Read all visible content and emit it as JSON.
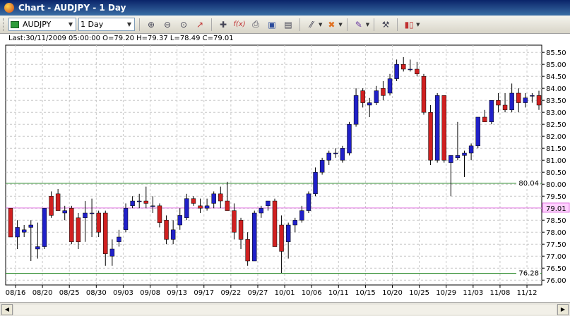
{
  "window": {
    "title": "Chart - AUDJPY - 1 Day"
  },
  "toolbar": {
    "symbol": "AUDJPY",
    "timeframe": "1 Day",
    "icons": [
      "zoom-in-icon",
      "zoom-out-icon",
      "zoom-fit-icon",
      "cursor-icon",
      "crosshair-icon",
      "fx-icon",
      "print-icon",
      "save-icon",
      "page-icon",
      "line-tool-icon",
      "fibonacci-icon",
      "drawing-icon",
      "settings-icon",
      "bars-icon"
    ]
  },
  "info": {
    "text": "Last:30/11/2009 05:00:00 O=79.20 H=79.37 L=78.49 C=79.01"
  },
  "colors": {
    "up": "#2020c8",
    "down": "#d02020",
    "grid": "#c8c8c8",
    "level_line": "#2a8a2a",
    "price_line": "#e070e0"
  },
  "chart_data": {
    "type": "candlestick",
    "symbol": "AUDJPY",
    "timeframe": "1 Day",
    "xlabels": [
      "08/16",
      "08/20",
      "08/25",
      "08/30",
      "09/03",
      "09/08",
      "09/13",
      "09/17",
      "09/22",
      "09/27",
      "10/01",
      "10/06",
      "10/11",
      "10/15",
      "10/20",
      "10/25",
      "10/29",
      "11/03",
      "11/08",
      "11/12"
    ],
    "ylabels": [
      "76.00",
      "76.50",
      "77.00",
      "77.50",
      "78.00",
      "78.50",
      "79.00",
      "79.50",
      "80.00",
      "80.50",
      "81.00",
      "81.50",
      "82.00",
      "82.50",
      "83.00",
      "83.50",
      "84.00",
      "84.50",
      "85.00",
      "85.50"
    ],
    "ylim": [
      75.8,
      85.8
    ],
    "levels": [
      {
        "label": "80.04",
        "value": 80.04
      },
      {
        "label": "76.28",
        "value": 76.28
      }
    ],
    "current_price": {
      "label": "79.01",
      "value": 79.01
    },
    "ohlc": [
      [
        79.0,
        79.0,
        77.9,
        77.8
      ],
      [
        77.8,
        78.5,
        77.3,
        78.2
      ],
      [
        78.0,
        78.3,
        77.8,
        78.1
      ],
      [
        78.2,
        78.5,
        76.8,
        78.3
      ],
      [
        77.3,
        78.4,
        76.9,
        77.4
      ],
      [
        77.4,
        79.0,
        77.3,
        79.0
      ],
      [
        79.5,
        79.7,
        78.6,
        78.7
      ],
      [
        79.6,
        79.8,
        78.9,
        78.9
      ],
      [
        78.8,
        79.1,
        78.5,
        78.9
      ],
      [
        79.0,
        79.1,
        77.5,
        77.6
      ],
      [
        78.6,
        78.8,
        77.3,
        77.6
      ],
      [
        78.6,
        79.3,
        77.6,
        78.8
      ],
      [
        78.8,
        79.4,
        77.8,
        78.8
      ],
      [
        78.8,
        78.9,
        77.8,
        78.0
      ],
      [
        78.8,
        78.9,
        76.6,
        77.1
      ],
      [
        77.0,
        77.7,
        76.6,
        77.3
      ],
      [
        77.6,
        78.1,
        77.4,
        77.8
      ],
      [
        78.1,
        79.2,
        78.0,
        79.0
      ],
      [
        79.1,
        79.5,
        79.0,
        79.3
      ],
      [
        79.3,
        79.6,
        79.0,
        79.3
      ],
      [
        79.3,
        79.9,
        79.0,
        79.2
      ],
      [
        79.1,
        79.5,
        78.8,
        79.1
      ],
      [
        79.1,
        79.2,
        78.2,
        78.4
      ],
      [
        78.5,
        78.7,
        77.5,
        77.7
      ],
      [
        77.7,
        78.5,
        77.5,
        78.1
      ],
      [
        78.3,
        79.0,
        78.1,
        78.7
      ],
      [
        78.6,
        79.6,
        78.5,
        79.4
      ],
      [
        79.4,
        79.5,
        79.1,
        79.2
      ],
      [
        79.1,
        79.4,
        78.8,
        79.0
      ],
      [
        79.0,
        79.4,
        78.9,
        79.1
      ],
      [
        79.2,
        79.7,
        79.0,
        79.6
      ],
      [
        79.6,
        79.9,
        79.0,
        79.3
      ],
      [
        79.3,
        80.1,
        79.1,
        78.9
      ],
      [
        78.9,
        79.2,
        77.7,
        78.0
      ],
      [
        78.5,
        78.6,
        77.3,
        77.7
      ],
      [
        77.7,
        78.0,
        76.6,
        76.8
      ],
      [
        76.8,
        78.9,
        76.8,
        78.8
      ],
      [
        78.8,
        79.1,
        78.6,
        79.0
      ],
      [
        79.1,
        79.3,
        78.9,
        79.3
      ],
      [
        79.3,
        79.4,
        77.8,
        77.4
      ],
      [
        78.3,
        78.7,
        76.3,
        77.2
      ],
      [
        77.6,
        78.4,
        76.9,
        78.3
      ],
      [
        78.3,
        78.6,
        78.0,
        78.5
      ],
      [
        78.5,
        79.1,
        78.4,
        78.9
      ],
      [
        78.9,
        79.7,
        78.8,
        79.6
      ],
      [
        79.6,
        80.7,
        79.5,
        80.5
      ],
      [
        80.5,
        81.1,
        80.4,
        81.0
      ],
      [
        81.0,
        81.4,
        80.8,
        81.3
      ],
      [
        81.3,
        81.5,
        81.1,
        81.3
      ],
      [
        81.0,
        81.6,
        80.9,
        81.5
      ],
      [
        81.3,
        82.6,
        81.2,
        82.5
      ],
      [
        82.5,
        84.0,
        82.4,
        83.7
      ],
      [
        83.9,
        84.0,
        83.2,
        83.4
      ],
      [
        83.3,
        83.6,
        82.8,
        83.4
      ],
      [
        83.4,
        84.1,
        83.3,
        83.9
      ],
      [
        84.0,
        84.3,
        83.5,
        83.7
      ],
      [
        83.8,
        84.6,
        83.7,
        84.4
      ],
      [
        84.4,
        85.2,
        84.3,
        85.0
      ],
      [
        85.0,
        85.3,
        84.7,
        84.8
      ],
      [
        84.8,
        85.2,
        84.7,
        84.8
      ],
      [
        84.8,
        85.1,
        84.5,
        84.6
      ],
      [
        84.5,
        84.6,
        82.9,
        83.0
      ],
      [
        83.0,
        83.3,
        80.8,
        81.0
      ],
      [
        81.0,
        83.8,
        80.9,
        83.7
      ],
      [
        83.7,
        83.7,
        80.9,
        81.0
      ],
      [
        80.9,
        81.2,
        79.5,
        81.2
      ],
      [
        81.1,
        82.6,
        81.0,
        81.2
      ],
      [
        81.2,
        81.4,
        80.3,
        81.3
      ],
      [
        81.3,
        81.7,
        81.0,
        81.6
      ],
      [
        81.6,
        82.8,
        81.5,
        82.8
      ],
      [
        82.8,
        83.1,
        82.6,
        82.6
      ],
      [
        82.6,
        83.5,
        82.5,
        83.5
      ],
      [
        83.5,
        83.8,
        83.0,
        83.3
      ],
      [
        83.3,
        83.8,
        83.0,
        83.1
      ],
      [
        83.1,
        84.2,
        83.0,
        83.8
      ],
      [
        83.8,
        84.0,
        83.0,
        83.4
      ],
      [
        83.4,
        83.8,
        83.2,
        83.6
      ],
      [
        83.7,
        83.8,
        83.4,
        83.7
      ],
      [
        83.7,
        83.9,
        83.1,
        83.3
      ]
    ]
  }
}
